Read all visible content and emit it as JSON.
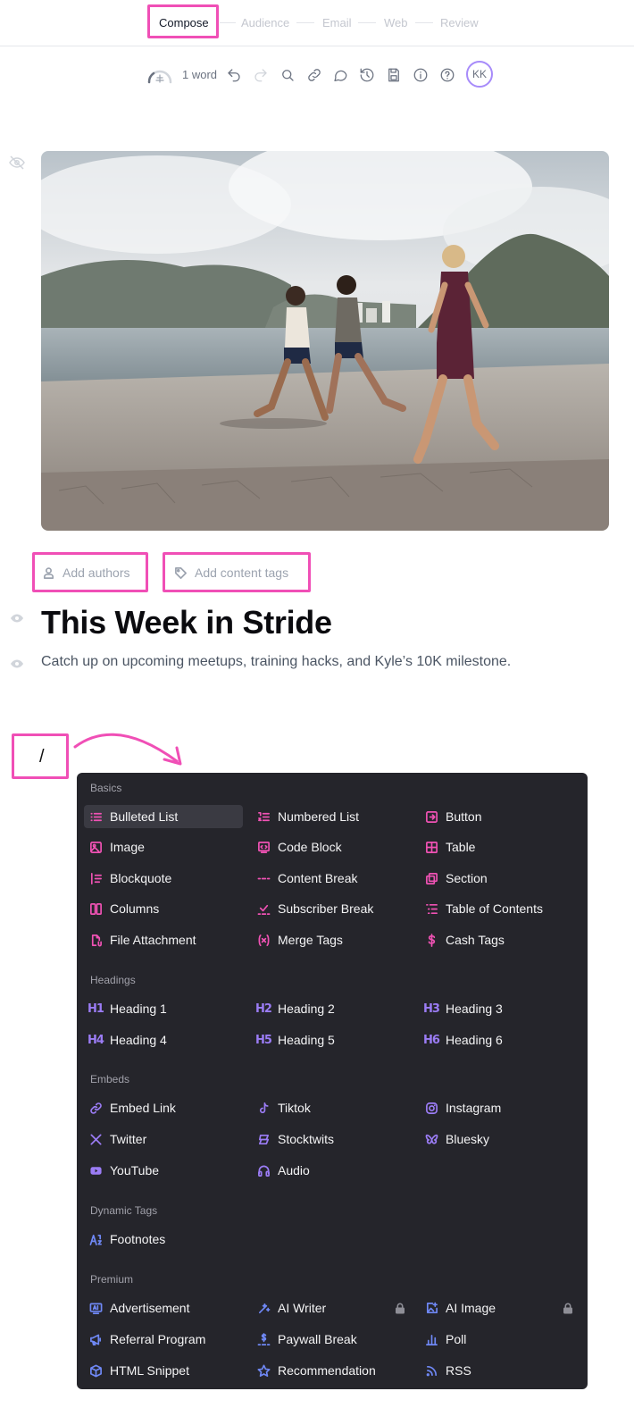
{
  "steps": [
    "Compose",
    "Audience",
    "Email",
    "Web",
    "Review"
  ],
  "active_step": "Compose",
  "toolbar": {
    "word_count": "1 word",
    "avatar_initials": "KK"
  },
  "post": {
    "add_authors": "Add authors",
    "add_content_tags": "Add content tags",
    "title": "This Week in Stride",
    "subtitle": "Catch up on upcoming meetups, training hacks, and Kyle’s 10K milestone.",
    "slash_text": "/"
  },
  "menu": {
    "sections": {
      "basics": "Basics",
      "headings": "Headings",
      "embeds": "Embeds",
      "dynamic": "Dynamic Tags",
      "premium": "Premium"
    },
    "basics": [
      "Bulleted List",
      "Numbered List",
      "Button",
      "Image",
      "Code Block",
      "Table",
      "Blockquote",
      "Content Break",
      "Section",
      "Columns",
      "Subscriber Break",
      "Table of Contents",
      "File Attachment",
      "Merge Tags",
      "Cash Tags"
    ],
    "headings": [
      "Heading 1",
      "Heading 2",
      "Heading 3",
      "Heading 4",
      "Heading 5",
      "Heading 6"
    ],
    "heading_icons": [
      "H1",
      "H2",
      "H3",
      "H4",
      "H5",
      "H6"
    ],
    "embeds": [
      "Embed Link",
      "Tiktok",
      "Instagram",
      "Twitter",
      "Stocktwits",
      "Bluesky",
      "YouTube",
      "Audio"
    ],
    "dynamic": [
      "Footnotes"
    ],
    "premium": [
      "Advertisement",
      "AI Writer",
      "AI Image",
      "Referral Program",
      "Paywall Break",
      "Poll",
      "HTML Snippet",
      "Recommendation",
      "RSS"
    ],
    "selected_item": "Bulleted List"
  },
  "colors": {
    "highlight": "#f04fb6",
    "menu_bg": "#25252b",
    "icon_pink": "#f052b4",
    "icon_purple": "#9b7cf5",
    "icon_blue": "#6f88f5"
  }
}
